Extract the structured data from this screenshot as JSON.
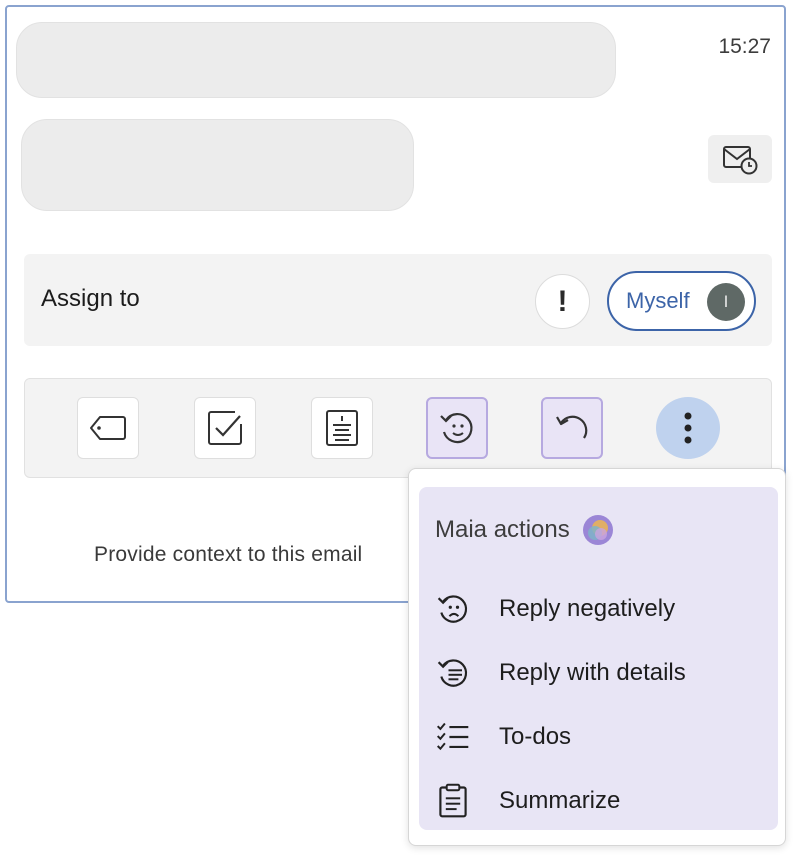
{
  "email": {
    "time": "15:27"
  },
  "assign": {
    "label": "Assign to",
    "urgent_symbol": "!",
    "myself_label": "Myself",
    "avatar_initial": "I"
  },
  "toolbar": {
    "icons": [
      "tag-icon",
      "checkbox-icon",
      "summary-document-icon",
      "reply-sad-face-icon",
      "undo-reply-icon",
      "more-vertical-icon"
    ]
  },
  "context": {
    "text": "Provide context to this email"
  },
  "menu": {
    "title": "Maia actions",
    "items": [
      {
        "label": "Reply negatively",
        "icon": "reply-negative-icon"
      },
      {
        "label": "Reply with details",
        "icon": "reply-details-icon"
      },
      {
        "label": "To-dos",
        "icon": "todo-list-icon"
      },
      {
        "label": "Summarize",
        "icon": "clipboard-icon"
      }
    ]
  },
  "colors": {
    "accent_blue": "#3c64a8",
    "ai_purple_bg": "#e8e5f5",
    "more_button": "#bfd2ee"
  }
}
